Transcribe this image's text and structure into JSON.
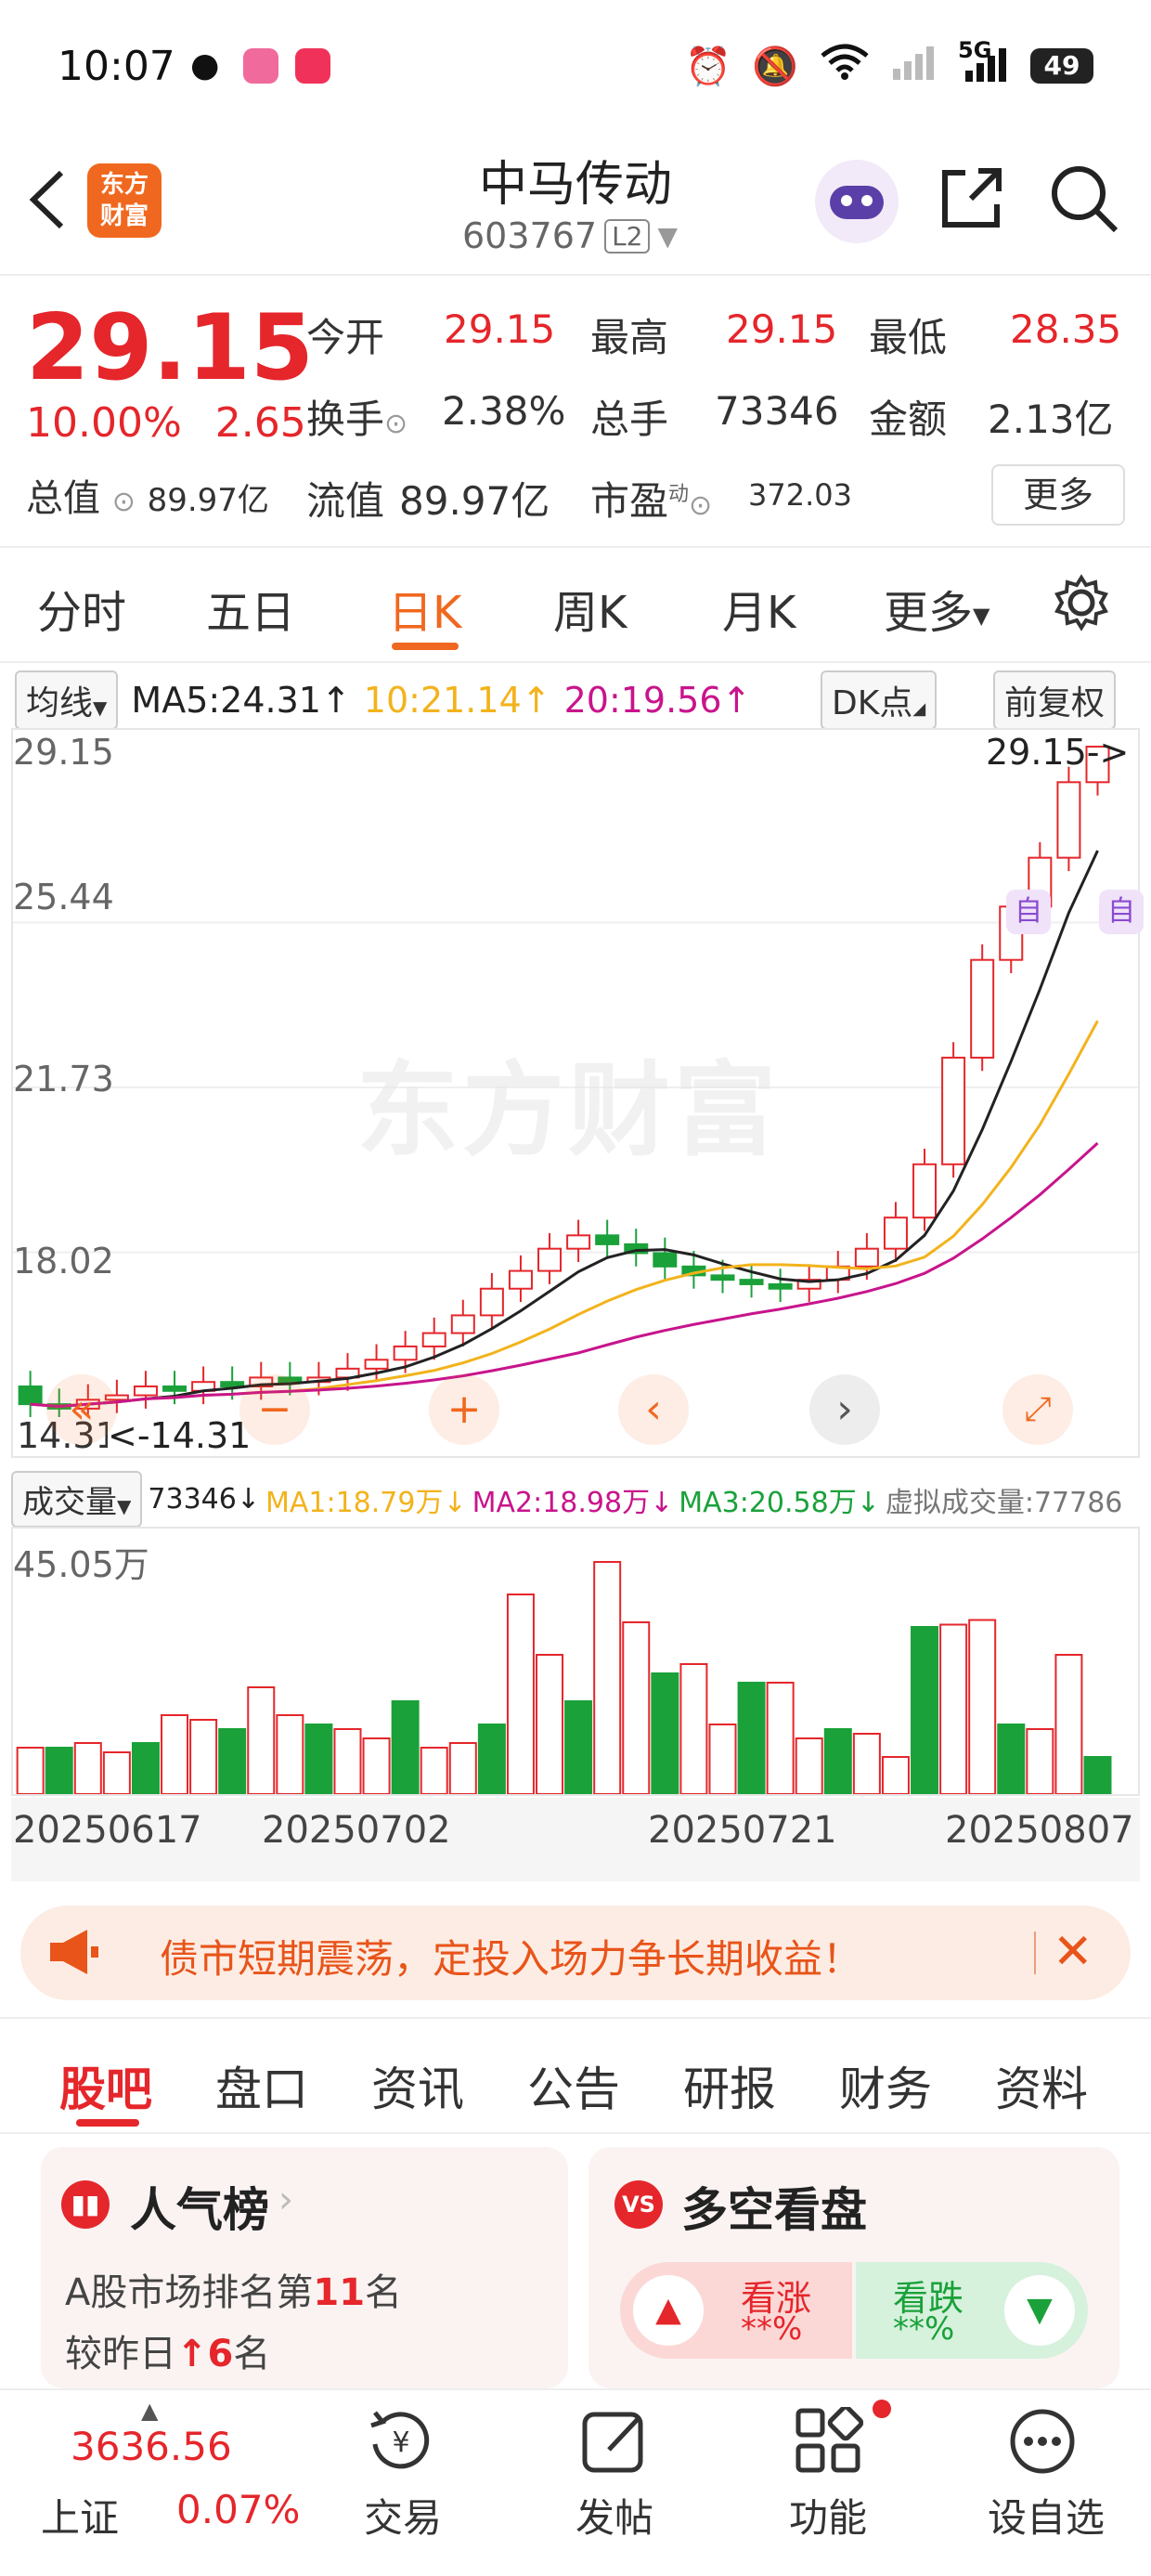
{
  "status_bar": {
    "time": "10:07",
    "battery": "49",
    "network": "5G"
  },
  "header": {
    "logo_text_1": "东方",
    "logo_text_2": "财富",
    "stock_name": "中马传动",
    "stock_code": "603767",
    "level_badge": "L2"
  },
  "quote": {
    "price": "29.15",
    "change_pct": "10.00%",
    "change_amt": "2.65",
    "open_label": "今开",
    "open": "29.15",
    "high_label": "最高",
    "high": "29.15",
    "low_label": "最低",
    "low": "28.35",
    "turnover_label": "换手",
    "turnover": "2.38%",
    "volume_label": "总手",
    "volume": "73346",
    "amount_label": "金额",
    "amount": "2.13亿",
    "mktcap_label": "总值",
    "mktcap": "89.97亿",
    "float_label": "流值",
    "float_val": "89.97亿",
    "pe_label": "市盈",
    "pe_sup": "动",
    "pe": "372.03",
    "more_label": "更多"
  },
  "period_tabs": [
    "分时",
    "五日",
    "日K",
    "周K",
    "月K",
    "更多",
    "settings"
  ],
  "active_tab": "日K",
  "indicator_bar": {
    "ma_select": "均线",
    "ma5": "MA5:24.31↑",
    "ma10": "10:21.14↑",
    "ma20": "20:19.56↑",
    "dk_label": "DK点",
    "adjust_label": "前复权"
  },
  "price_axis": [
    "29.15",
    "25.44",
    "21.73",
    "18.02",
    "14.31"
  ],
  "last_price_tag": "29.15->",
  "min_price_tag": "<-14.31",
  "self_tag": "自",
  "watermark": "东方财富",
  "volume_bar": {
    "select": "成交量",
    "vol": "73346↓",
    "ma1": "MA1:18.79万↓",
    "ma2": "MA2:18.98万↓",
    "ma3": "MA3:20.58万↓",
    "virtual": "虚拟成交量:77786",
    "max_label": "45.05万"
  },
  "date_axis": [
    "20250617",
    "20250702",
    "20250721",
    "20250807"
  ],
  "colors": {
    "up": "#e5262b",
    "down": "#1aa13a",
    "accent": "#f0681f",
    "ma5": "#222222",
    "ma10": "#f2b31c",
    "ma20": "#c8148c"
  },
  "banner": {
    "text": "债市短期震荡，定投入场力争长期收益！"
  },
  "content_tabs": [
    "股吧",
    "盘口",
    "资讯",
    "公告",
    "研报",
    "财务",
    "资料"
  ],
  "active_content_tab": "股吧",
  "popularity_card": {
    "title": "人气榜",
    "line1_a": "A股市场排名第",
    "rank": "11",
    "line1_b": "名",
    "line2_a": "较昨日",
    "up_arrow": "↑",
    "delta": "6",
    "line2_b": "名"
  },
  "sentiment_card": {
    "icon": "VS",
    "title": "多空看盘",
    "bull_label": "看涨",
    "bull_pct": "**%",
    "bear_label": "看跌",
    "bear_pct": "**%"
  },
  "footer": {
    "index_value": "3636.56",
    "index_name": "上证",
    "index_change": "0.07%",
    "items": [
      "交易",
      "发帖",
      "功能",
      "设自选"
    ]
  }
}
